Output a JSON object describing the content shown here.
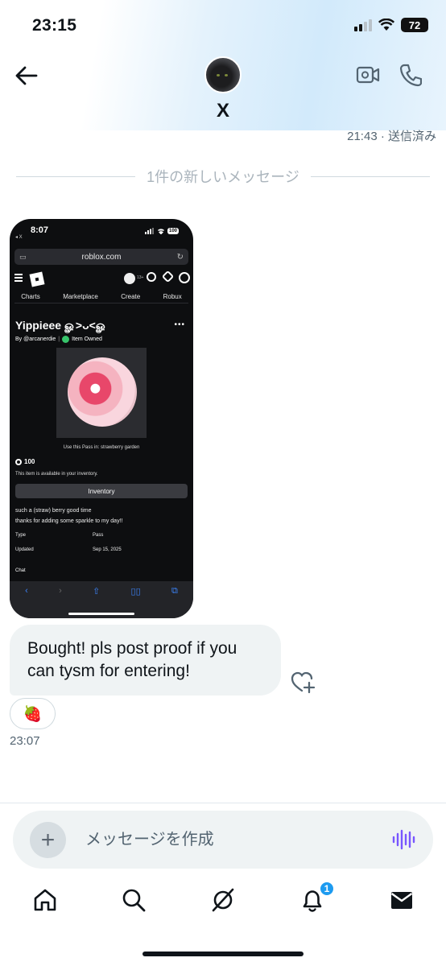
{
  "status_bar": {
    "time": "23:15",
    "battery": "72"
  },
  "header": {
    "contact_name": "X"
  },
  "conversation": {
    "previous_timestamp": "21:43 · 送信済み",
    "new_messages_divider": "1件の新しいメッセージ",
    "message_text": "Bought! pls post proof if you can tysm for entering!",
    "reaction_emoji": "🍓",
    "message_time": "23:07"
  },
  "attachment": {
    "time": "8:07",
    "back_label": "◂ X",
    "battery": "100",
    "url": "roblox.com",
    "age_tag": "13+",
    "nav_tabs": [
      "Charts",
      "Marketplace",
      "Create",
      "Robux"
    ],
    "title": "Yippieee ௐ>ᴗ<ௐ",
    "creator": "By @arcanerdie",
    "owned_label": "Item Owned",
    "use_in": "Use this Pass in: strawberry garden",
    "price": "100",
    "availability": "This item is available in your inventory.",
    "inventory_button": "Inventory",
    "description_line1": "such a (straw) berry good time",
    "description_line2": "thanks for adding some sparkle to my day!!",
    "type_label": "Type",
    "type_value": "Pass",
    "updated_label": "Updated",
    "updated_value": "Sep 15, 2025",
    "chat_label": "Chat"
  },
  "composer": {
    "placeholder": "メッセージを作成"
  },
  "tab_bar": {
    "notification_badge": "1"
  },
  "colors": {
    "accent": "#1d9bf0",
    "voice": "#7856ff",
    "bubble": "#eff3f4"
  },
  "icons": [
    "back-arrow-icon",
    "video-camera-icon",
    "phone-icon",
    "heart-plus-icon",
    "plus-icon",
    "voice-waveform-icon",
    "home-icon",
    "search-icon",
    "grok-icon",
    "bell-icon",
    "mail-icon"
  ]
}
